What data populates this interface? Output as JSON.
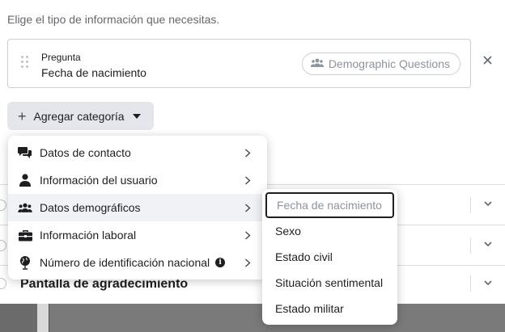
{
  "instruction": "Elige el tipo de información que necesitas.",
  "question": {
    "label": "Pregunta",
    "value": "Fecha de nacimiento",
    "tag_label": "Demographic Questions",
    "tag_icon": "people-icon"
  },
  "add_category": {
    "label": "Agregar categoría"
  },
  "menu": {
    "items": [
      {
        "label": "Datos de contacto",
        "icon": "chat-bubbles-icon"
      },
      {
        "label": "Información del usuario",
        "icon": "person-icon"
      },
      {
        "label": "Datos demográficos",
        "icon": "people-icon",
        "active": true
      },
      {
        "label": "Información laboral",
        "icon": "briefcase-icon"
      },
      {
        "label": "Número de identificación nacional",
        "icon": "globe-icon",
        "info": true
      }
    ]
  },
  "submenu": {
    "items": [
      {
        "label": "Fecha de nacimiento",
        "selected": true
      },
      {
        "label": "Sexo"
      },
      {
        "label": "Estado civil"
      },
      {
        "label": "Situación sentimental"
      },
      {
        "label": "Estado militar"
      }
    ]
  },
  "background": {
    "thank_you_title": "Pantalla de agradecimiento"
  }
}
